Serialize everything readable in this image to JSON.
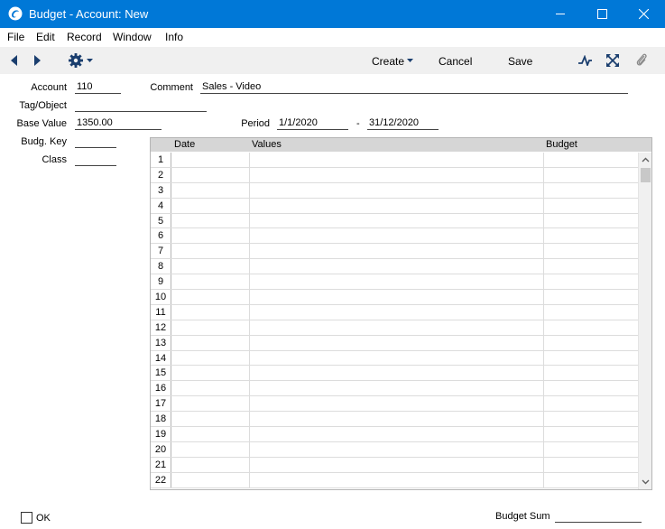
{
  "window": {
    "title": "Budget - Account: New"
  },
  "menu": [
    "File",
    "Edit",
    "Record",
    "Window",
    "Info"
  ],
  "toolbar": {
    "create": "Create",
    "cancel": "Cancel",
    "save": "Save"
  },
  "form": {
    "account_label": "Account",
    "account_value": "110",
    "comment_label": "Comment",
    "comment_value": "Sales - Video",
    "tag_label": "Tag/Object",
    "tag_value": "",
    "base_value_label": "Base Value",
    "base_value_value": "1350.00",
    "period_label": "Period",
    "period_from": "1/1/2020",
    "period_sep": "-",
    "period_to": "31/12/2020",
    "budg_key_label": "Budg. Key",
    "budg_key_value": "",
    "class_label": "Class",
    "class_value": ""
  },
  "grid": {
    "columns": [
      "Date",
      "Values",
      "Budget"
    ],
    "row_numbers": [
      "1",
      "2",
      "3",
      "4",
      "5",
      "6",
      "7",
      "8",
      "9",
      "10",
      "11",
      "12",
      "13",
      "14",
      "15",
      "16",
      "17",
      "18",
      "19",
      "20",
      "21",
      "22"
    ]
  },
  "footer": {
    "ok_label": "OK",
    "budget_sum_label": "Budget Sum",
    "budget_sum_value": ""
  },
  "colors": {
    "titlebar": "#0078d7",
    "toolbar": "#f0f0f0",
    "grid_header": "#d6d6d6"
  }
}
